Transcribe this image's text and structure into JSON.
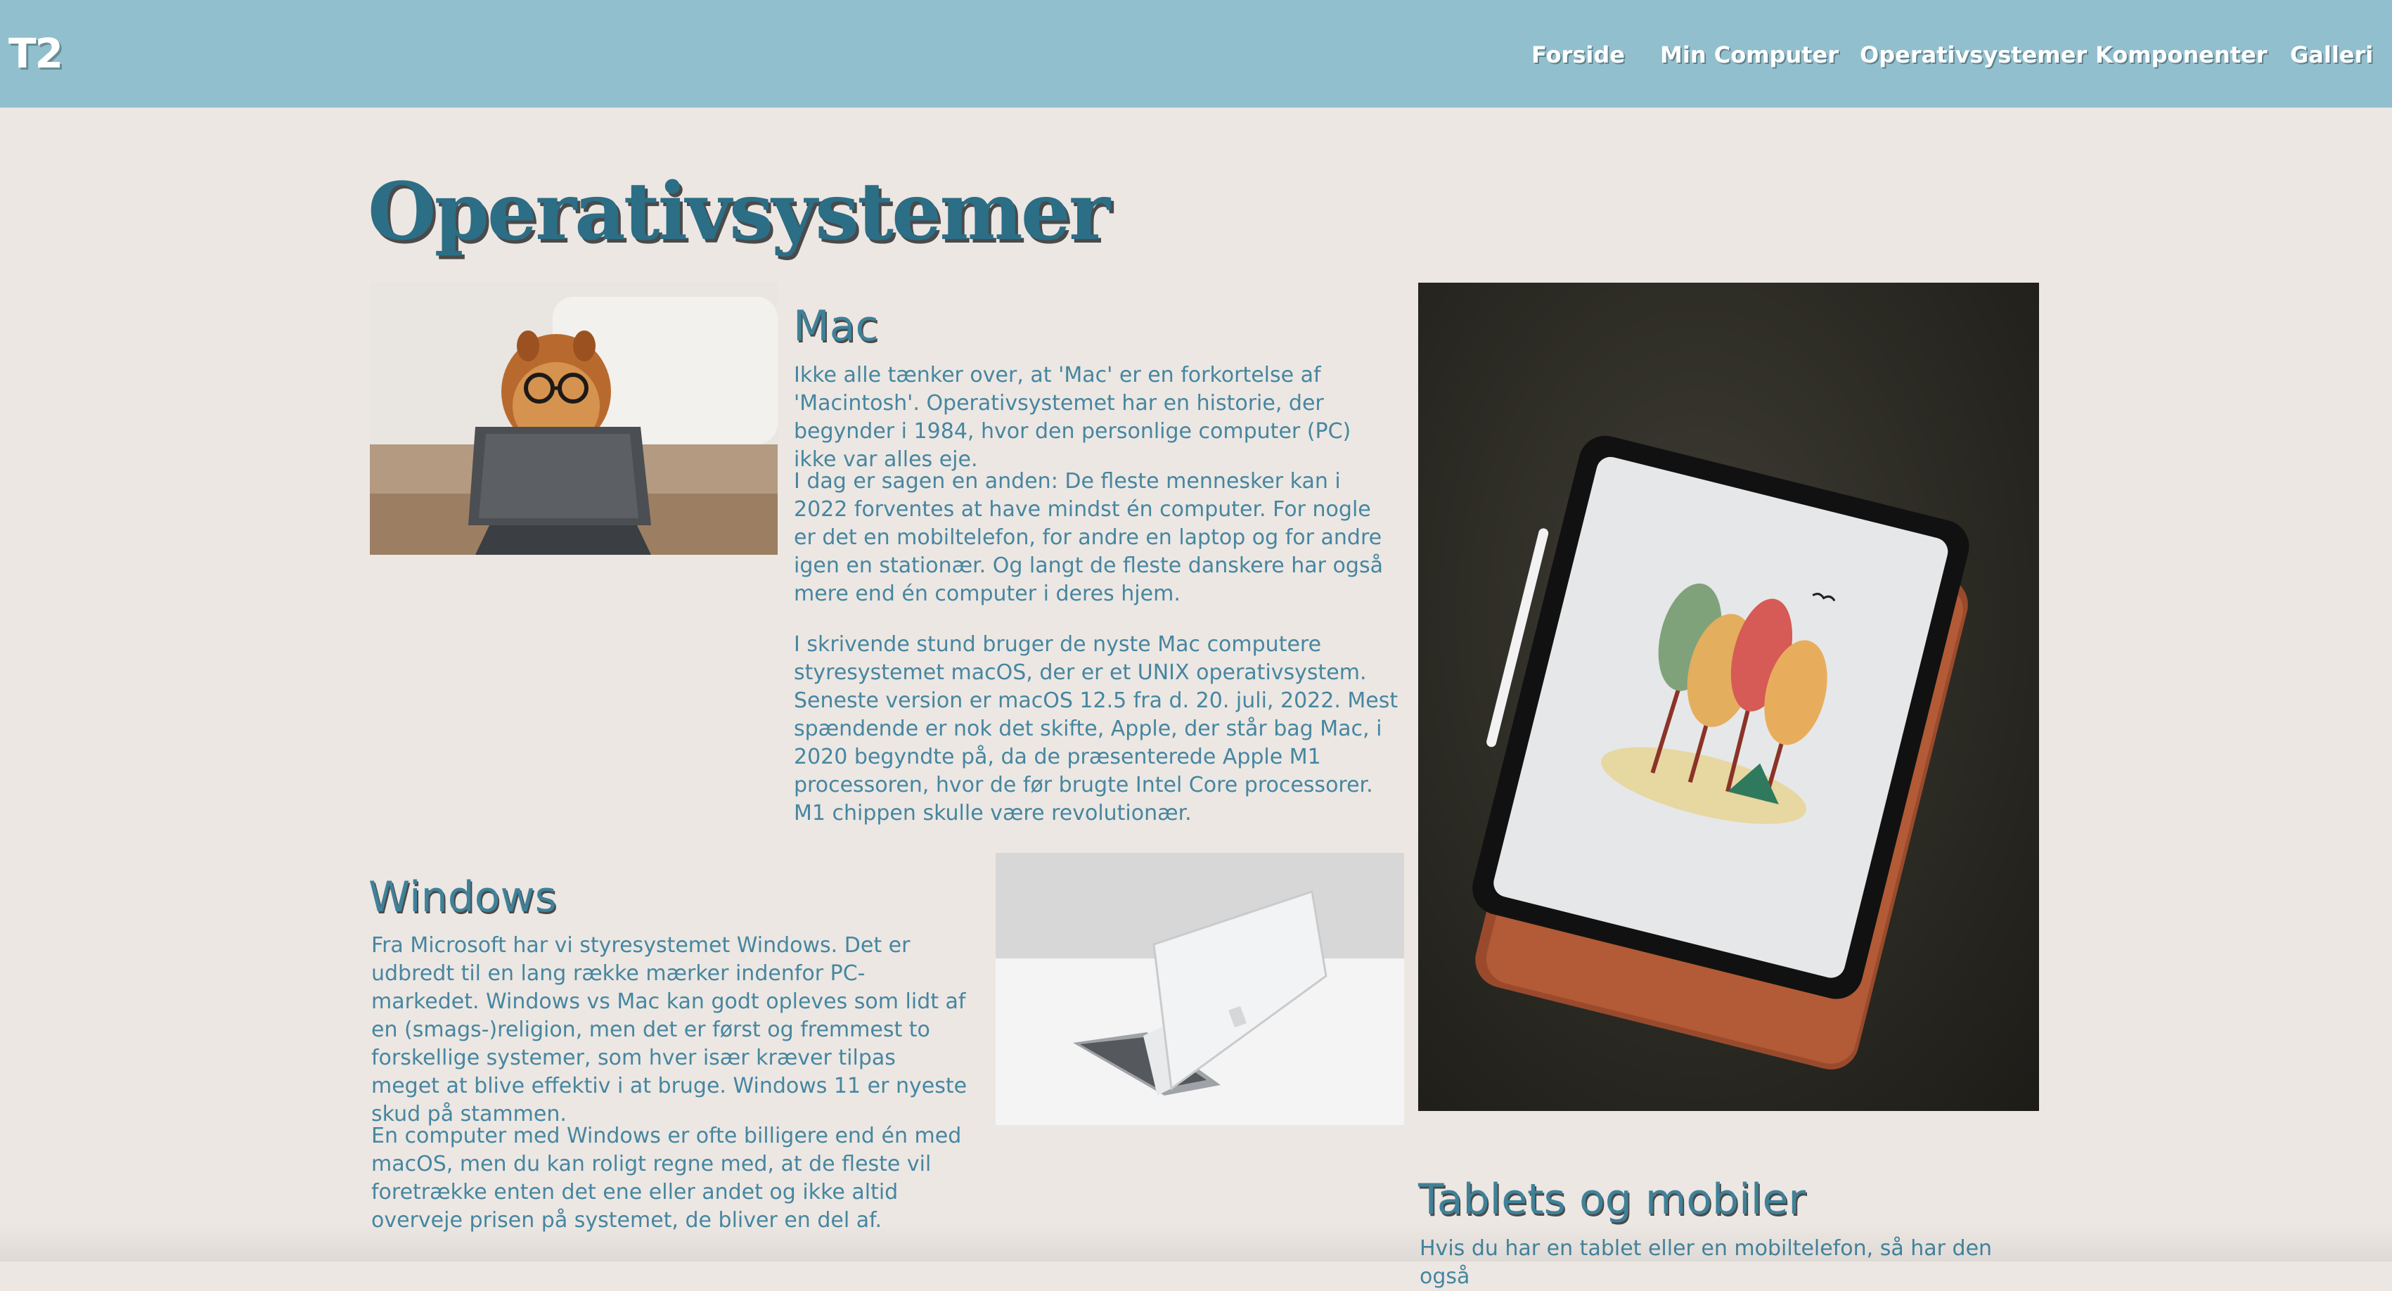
{
  "nav": {
    "logo": "T2",
    "links": [
      "Forside",
      "Min Computer",
      "Operativsystemer",
      "Komponenter",
      "Galleri"
    ]
  },
  "page": {
    "title": "Operativsystemer"
  },
  "mac": {
    "heading": "Mac",
    "paragraphs": [
      "Ikke alle tænker over, at 'Mac' er en forkortelse af 'Macintosh'. Operativsystemet har en historie, der begynder i 1984, hvor den personlige computer (PC) ikke var alles eje.",
      "I dag er sagen en anden: De fleste mennesker kan i 2022 forventes at have mindst én computer. For nogle er det en mobiltelefon, for andre en laptop og for andre igen en stationær. Og langt de fleste danskere har også mere end én computer i deres hjem.",
      "I skrivende stund bruger de nyste Mac computere styresystemet macOS, der er et UNIX operativsystem. Seneste version er macOS 12.5 fra d. 20. juli, 2022. Mest spændende er nok det skifte, Apple, der står bag Mac, i 2020 begyndte på, da de præsenterede Apple M1 processoren, hvor de før brugte Intel Core processorer. M1 chippen skulle være revolutionær."
    ]
  },
  "windows": {
    "heading": "Windows",
    "paragraphs": [
      "Fra Microsoft har vi styresystemet Windows. Det er udbredt til en lang række mærker indenfor PC-markedet. Windows vs Mac kan godt opleves som lidt af en (smags-)religion, men det er først og fremmest to forskellige systemer, som hver især kræver tilpas meget at blive effektiv i at bruge. Windows 11 er nyeste skud på stammen.",
      "En computer med Windows er ofte billigere end én med macOS, men du kan roligt regne med, at de fleste vil foretrække enten det ene eller andet og ikke altid overveje prisen på systemet, de bliver en del af."
    ]
  },
  "tablets": {
    "heading": "Tablets og mobiler",
    "paragraphs": [
      "Hvis du har en tablet eller en mobiltelefon, så har den også"
    ]
  },
  "colors": {
    "nav_background": "#92bfcd",
    "page_background": "#ece7e3",
    "title": "#2b6e86",
    "text": "#4686a0"
  },
  "images": {
    "dog": "dog-with-glasses-at-tablet-photo",
    "laptop": "silver-laptop-photo",
    "tablet": "tablet-with-tree-drawing-photo"
  }
}
